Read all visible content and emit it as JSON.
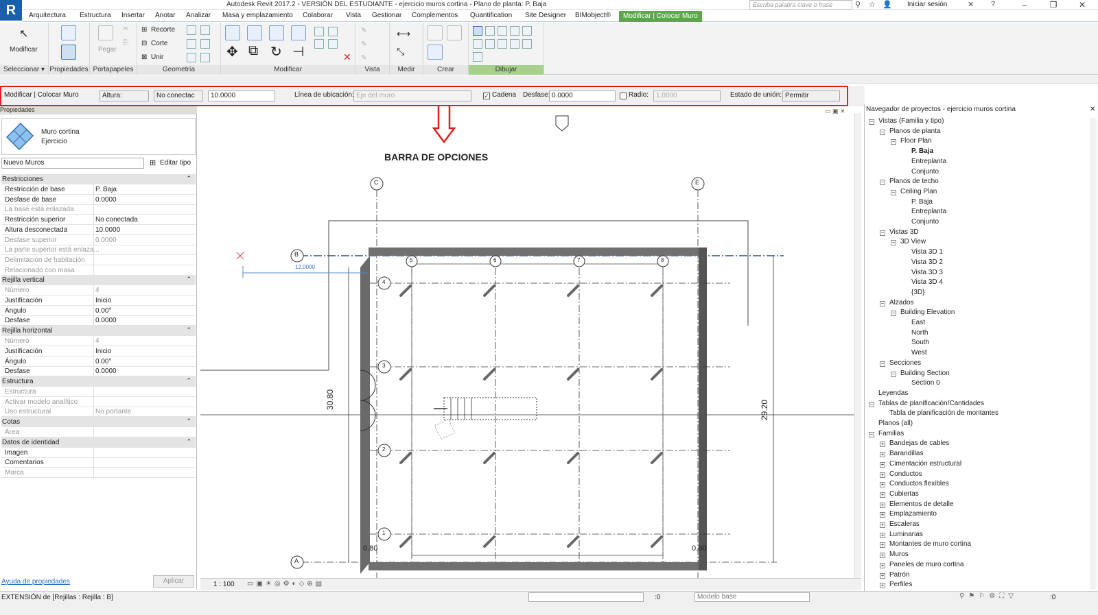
{
  "window": {
    "title": "Autodesk Revit 2017.2 - VERSIÓN DEL ESTUDIANTE -     ejercicio muros cortina - Plano de planta: P. Baja",
    "app_icon": "R",
    "search_placeholder": "Escriba palabra clave o frase",
    "signin": "Iniciar sesión"
  },
  "menu": [
    "Arquitectura",
    "Estructura",
    "Insertar",
    "Anotar",
    "Analizar",
    "Masa y emplazamiento",
    "Colaborar",
    "Vista",
    "Gestionar",
    "Complementos",
    "Quantification",
    "Site Designer",
    "BIMobject®",
    "Modificar | Colocar Muro"
  ],
  "ribbon": {
    "groups": [
      "Seleccionar ▾",
      "Propiedades",
      "Portapapeles",
      "Geometría",
      "Modificar",
      "Vista",
      "Medir",
      "Crear",
      "Dibujar"
    ],
    "modify_label": "Modificar",
    "paste_label": "Pegar",
    "recorte": "Recorte",
    "corte": "Corte",
    "unir": "Unir"
  },
  "options_bar": {
    "context": "Modificar | Colocar Muro",
    "height_label": "Altura:",
    "top_constraint": "No conectac",
    "height_value": "10.0000",
    "location_label": "Línea de ubicación:",
    "location_value": "Eje del muro",
    "chain_label": "Cadena",
    "chain_checked": true,
    "offset_label": "Desfase:",
    "offset_value": "0.0000",
    "radius_label": "Radio:",
    "radius_checked": false,
    "radius_value": "1.0000",
    "join_label": "Estado de unión:",
    "join_value": "Permitir"
  },
  "properties": {
    "header": "Propiedades",
    "type_name": "Muro cortina",
    "type_sub": "Ejercicio",
    "instance_dropdown": "Nuevo Muros",
    "edit_type": "Editar tipo",
    "help_link": "Ayuda de propiedades",
    "apply": "Aplicar",
    "rows": [
      {
        "k": "Restricciones",
        "v": "",
        "s": "sec"
      },
      {
        "k": "Restricción de base",
        "v": "P. Baja",
        "s": ""
      },
      {
        "k": "Desfase de base",
        "v": "0.0000",
        "s": ""
      },
      {
        "k": "La base está enlazada",
        "v": "",
        "s": "dim"
      },
      {
        "k": "Restricción superior",
        "v": "No conectada",
        "s": ""
      },
      {
        "k": "Altura desconectada",
        "v": "10.0000",
        "s": ""
      },
      {
        "k": "Desfase superior",
        "v": "0.0000",
        "s": "dim"
      },
      {
        "k": "La parte superior está enlaza...",
        "v": "",
        "s": "dim"
      },
      {
        "k": "Delimitación de habitación",
        "v": "",
        "s": "dim"
      },
      {
        "k": "Relacionado con masa",
        "v": "",
        "s": "dim"
      },
      {
        "k": "Rejilla vertical",
        "v": "",
        "s": "sec"
      },
      {
        "k": "Número",
        "v": "4",
        "s": "dim"
      },
      {
        "k": "Justificación",
        "v": "Inicio",
        "s": ""
      },
      {
        "k": "Ángulo",
        "v": "0.00°",
        "s": ""
      },
      {
        "k": "Desfase",
        "v": "0.0000",
        "s": ""
      },
      {
        "k": "Rejilla horizontal",
        "v": "",
        "s": "sec"
      },
      {
        "k": "Número",
        "v": "4",
        "s": "dim"
      },
      {
        "k": "Justificación",
        "v": "Inicio",
        "s": ""
      },
      {
        "k": "Ángulo",
        "v": "0.00°",
        "s": ""
      },
      {
        "k": "Desfase",
        "v": "0.0000",
        "s": ""
      },
      {
        "k": "Estructura",
        "v": "",
        "s": "sec"
      },
      {
        "k": "Estructura",
        "v": "",
        "s": "dim"
      },
      {
        "k": "Activar modelo analítico",
        "v": "",
        "s": "dim"
      },
      {
        "k": "Uso estructural",
        "v": "No portante",
        "s": "dim"
      },
      {
        "k": "Cotas",
        "v": "",
        "s": "sec"
      },
      {
        "k": "Área",
        "v": "",
        "s": "dim"
      },
      {
        "k": "Datos de identidad",
        "v": "",
        "s": "sec"
      },
      {
        "k": "Imagen",
        "v": "",
        "s": ""
      },
      {
        "k": "Comentarios",
        "v": "",
        "s": ""
      },
      {
        "k": "Marca",
        "v": "",
        "s": "dim"
      }
    ]
  },
  "canvas": {
    "annotation": "BARRA DE OPCIONES",
    "grid_top": [
      "C",
      "E"
    ],
    "grid_left": [
      "B",
      "A"
    ],
    "row_bubbles": [
      "4",
      "3",
      "2",
      "1"
    ],
    "col_bubbles": [
      "5",
      "6",
      "7",
      "8"
    ],
    "dim_left": "30.80",
    "dim_right": "29.20",
    "temp_dim": "12.0000",
    "dim_small": "0.80",
    "scale": "1 : 100"
  },
  "navigator": {
    "title": "Navegador de proyectos - ejercicio muros cortina",
    "items": [
      {
        "t": "Vistas (Familia y tipo)",
        "l": 0,
        "tog": "−"
      },
      {
        "t": "Planos de planta",
        "l": 1,
        "tog": "−"
      },
      {
        "t": "Floor Plan",
        "l": 2,
        "tog": "−"
      },
      {
        "t": "P. Baja",
        "l": 3,
        "tog": "",
        "b": true
      },
      {
        "t": "Entreplanta",
        "l": 3,
        "tog": ""
      },
      {
        "t": "Conjunto",
        "l": 3,
        "tog": ""
      },
      {
        "t": "Planos de techo",
        "l": 1,
        "tog": "−"
      },
      {
        "t": "Ceiling Plan",
        "l": 2,
        "tog": "−"
      },
      {
        "t": "P. Baja",
        "l": 3,
        "tog": ""
      },
      {
        "t": "Entreplanta",
        "l": 3,
        "tog": ""
      },
      {
        "t": "Conjunto",
        "l": 3,
        "tog": ""
      },
      {
        "t": "Vistas 3D",
        "l": 1,
        "tog": "−"
      },
      {
        "t": "3D View",
        "l": 2,
        "tog": "−"
      },
      {
        "t": "Vista 3D 1",
        "l": 3,
        "tog": ""
      },
      {
        "t": "Vista 3D 2",
        "l": 3,
        "tog": ""
      },
      {
        "t": "Vista 3D 3",
        "l": 3,
        "tog": ""
      },
      {
        "t": "Vista 3D 4",
        "l": 3,
        "tog": ""
      },
      {
        "t": "{3D}",
        "l": 3,
        "tog": ""
      },
      {
        "t": "Alzados",
        "l": 1,
        "tog": "−"
      },
      {
        "t": "Building Elevation",
        "l": 2,
        "tog": "−"
      },
      {
        "t": "East",
        "l": 3,
        "tog": ""
      },
      {
        "t": "North",
        "l": 3,
        "tog": ""
      },
      {
        "t": "South",
        "l": 3,
        "tog": ""
      },
      {
        "t": "West",
        "l": 3,
        "tog": ""
      },
      {
        "t": "Secciones",
        "l": 1,
        "tog": "−"
      },
      {
        "t": "Building Section",
        "l": 2,
        "tog": "−"
      },
      {
        "t": "Section 0",
        "l": 3,
        "tog": ""
      },
      {
        "t": "Leyendas",
        "l": 0,
        "tog": ""
      },
      {
        "t": "Tablas de planificación/Cantidades",
        "l": 0,
        "tog": "−"
      },
      {
        "t": "Tabla de planificación de montantes",
        "l": 1,
        "tog": ""
      },
      {
        "t": "Planos (all)",
        "l": 0,
        "tog": ""
      },
      {
        "t": "Familias",
        "l": 0,
        "tog": "−"
      },
      {
        "t": "Bandejas de cables",
        "l": 1,
        "tog": "+"
      },
      {
        "t": "Barandillas",
        "l": 1,
        "tog": "+"
      },
      {
        "t": "Cimentación estructural",
        "l": 1,
        "tog": "+"
      },
      {
        "t": "Conductos",
        "l": 1,
        "tog": "+"
      },
      {
        "t": "Conductos flexibles",
        "l": 1,
        "tog": "+"
      },
      {
        "t": "Cubiertas",
        "l": 1,
        "tog": "+"
      },
      {
        "t": "Elementos de detalle",
        "l": 1,
        "tog": "+"
      },
      {
        "t": "Emplazamiento",
        "l": 1,
        "tog": "+"
      },
      {
        "t": "Escaleras",
        "l": 1,
        "tog": "+"
      },
      {
        "t": "Luminarias",
        "l": 1,
        "tog": "+"
      },
      {
        "t": "Montantes de muro cortina",
        "l": 1,
        "tog": "+"
      },
      {
        "t": "Muros",
        "l": 1,
        "tog": "+"
      },
      {
        "t": "Paneles de muro cortina",
        "l": 1,
        "tog": "+"
      },
      {
        "t": "Patrón",
        "l": 1,
        "tog": "+"
      },
      {
        "t": "Perfiles",
        "l": 1,
        "tog": "+"
      }
    ]
  },
  "status": {
    "text": "EXTENSIÓN  de [Rejillas : Rejilla : B]",
    "model": "Modelo base",
    "zero1": ":0",
    "zero2": ":0"
  }
}
